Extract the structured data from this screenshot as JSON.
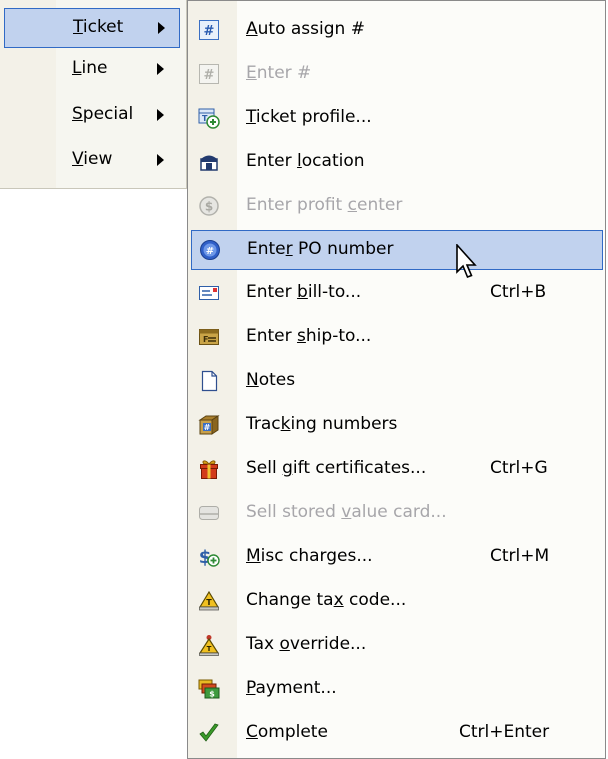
{
  "parent_menu": {
    "items": [
      {
        "pre": "",
        "acc": "T",
        "post": "icket",
        "selected": true,
        "has_submenu": true
      },
      {
        "pre": "",
        "acc": "L",
        "post": "ine",
        "selected": false,
        "has_submenu": true
      },
      {
        "pre": "",
        "acc": "S",
        "post": "pecial",
        "selected": false,
        "has_submenu": true
      },
      {
        "pre": "",
        "acc": "V",
        "post": "iew",
        "selected": false,
        "has_submenu": true
      }
    ]
  },
  "ticket_menu": {
    "items": [
      {
        "icon": "hash-blue-icon",
        "pre": "",
        "acc": "A",
        "post": "uto assign #",
        "shortcut": "",
        "disabled": false,
        "selected": false
      },
      {
        "icon": "hash-gray-icon",
        "pre": "",
        "acc": "E",
        "post": "nter #",
        "shortcut": "",
        "disabled": true,
        "selected": false
      },
      {
        "icon": "ticket-profile-icon",
        "pre": "",
        "acc": "T",
        "post": "icket profile...",
        "shortcut": "",
        "disabled": false,
        "selected": false
      },
      {
        "icon": "store-location-icon",
        "pre": "Enter ",
        "acc": "l",
        "post": "ocation",
        "shortcut": "",
        "disabled": false,
        "selected": false
      },
      {
        "icon": "profit-center-icon",
        "pre": "Enter profit ",
        "acc": "c",
        "post": "enter",
        "shortcut": "",
        "disabled": true,
        "selected": false
      },
      {
        "icon": "po-number-icon",
        "pre": "Ente",
        "acc": "r",
        "post": " PO number",
        "shortcut": "",
        "disabled": false,
        "selected": true
      },
      {
        "icon": "bill-to-icon",
        "pre": "Enter ",
        "acc": "b",
        "post": "ill-to...",
        "shortcut": "Ctrl+B",
        "disabled": false,
        "selected": false
      },
      {
        "icon": "ship-to-icon",
        "pre": "Enter ",
        "acc": "s",
        "post": "hip-to...",
        "shortcut": "",
        "disabled": false,
        "selected": false
      },
      {
        "icon": "notes-icon",
        "pre": "",
        "acc": "N",
        "post": "otes",
        "shortcut": "",
        "disabled": false,
        "selected": false
      },
      {
        "icon": "tracking-box-icon",
        "pre": "Trac",
        "acc": "k",
        "post": "ing numbers",
        "shortcut": "",
        "disabled": false,
        "selected": false
      },
      {
        "icon": "gift-icon",
        "pre": "Sell ",
        "acc": "g",
        "post": "ift certificates...",
        "shortcut": "Ctrl+G",
        "disabled": false,
        "selected": false
      },
      {
        "icon": "stored-value-card-icon",
        "pre": "Sell stored ",
        "acc": "v",
        "post": "alue card...",
        "shortcut": "",
        "disabled": true,
        "selected": false
      },
      {
        "icon": "misc-charges-icon",
        "pre": "",
        "acc": "M",
        "post": "isc charges...",
        "shortcut": "Ctrl+M",
        "disabled": false,
        "selected": false
      },
      {
        "icon": "tax-code-icon",
        "pre": "Change ta",
        "acc": "x",
        "post": " code...",
        "shortcut": "",
        "disabled": false,
        "selected": false
      },
      {
        "icon": "tax-override-icon",
        "pre": "Tax ",
        "acc": "o",
        "post": "verride...",
        "shortcut": "",
        "disabled": false,
        "selected": false
      },
      {
        "icon": "payment-icon",
        "pre": "",
        "acc": "P",
        "post": "ayment...",
        "shortcut": "",
        "disabled": false,
        "selected": false
      },
      {
        "icon": "checkmark-icon",
        "pre": "",
        "acc": "C",
        "post": "omplete",
        "shortcut": "Ctrl+Enter",
        "disabled": false,
        "selected": false
      }
    ]
  },
  "colors": {
    "highlight_fill": "#c1d2ee",
    "highlight_border": "#316ac5",
    "disabled_text": "#a7a6aa"
  }
}
